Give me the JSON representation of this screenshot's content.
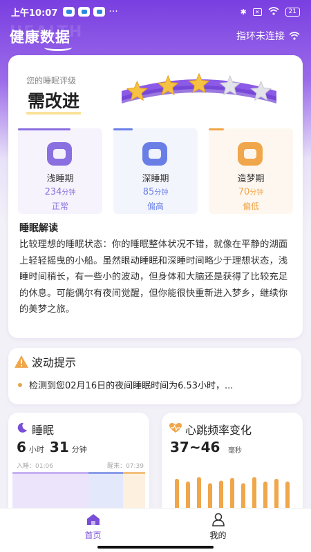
{
  "status_bar": {
    "time": "上午10:07",
    "battery": "21"
  },
  "header": {
    "watermark": "HEALTH",
    "title": "健康数据",
    "band_status": "指环未连接"
  },
  "sleep_rating": {
    "label": "您的睡眠评级",
    "value": "需改进",
    "stars_filled": 3,
    "stars_total": 5
  },
  "stages": [
    {
      "name": "浅睡期",
      "minutes": "234",
      "unit": "分钟",
      "level": "正常",
      "color": "#8a6fe0",
      "bg": "#f6f3fd"
    },
    {
      "name": "深睡期",
      "minutes": "85",
      "unit": "分钟",
      "level": "偏高",
      "color": "#6a7fe6",
      "bg": "#f3f5fd"
    },
    {
      "name": "造梦期",
      "minutes": "70",
      "unit": "分钟",
      "level": "偏低",
      "color": "#f0a64a",
      "bg": "#fdf7ef"
    }
  ],
  "interpretation": {
    "title": "睡眠解读",
    "text": "比较理想的睡眠状态：你的睡眠整体状况不错，就像在平静的湖面上轻轻摇曳的小船。虽然眼动睡眠和深睡时间略少于理想状态，浅睡时间稍长，有一些小的波动，但身体和大脑还是获得了比较充足的休息。可能偶尔有夜间觉醒，但你能很快重新进入梦乡，继续你的美梦之旅。"
  },
  "alert": {
    "title": "波动提示",
    "message": "检测到您02月16日的夜间睡眠时间为6.53小时，..."
  },
  "sleep_card": {
    "title": "睡眠",
    "hours": "6",
    "hours_unit": "小时",
    "minutes": "31",
    "minutes_unit": "分钟",
    "sleep_time": "入睡：01:06",
    "wake_time": "醒来：07:39"
  },
  "heart_card": {
    "title": "心跳频率变化",
    "range": "37~46",
    "unit": "毫秒",
    "bar_levels": [
      0.72,
      0.66,
      0.76,
      0.62,
      0.68,
      0.74,
      0.62,
      0.76,
      0.66,
      0.72,
      0.66
    ]
  },
  "tabs": [
    {
      "label": "首页",
      "active": true
    },
    {
      "label": "我的",
      "active": false
    }
  ],
  "colors": {
    "accent": "#7a3fe0",
    "orange": "#f0a64a",
    "tab_active": "#7a4fd8"
  }
}
